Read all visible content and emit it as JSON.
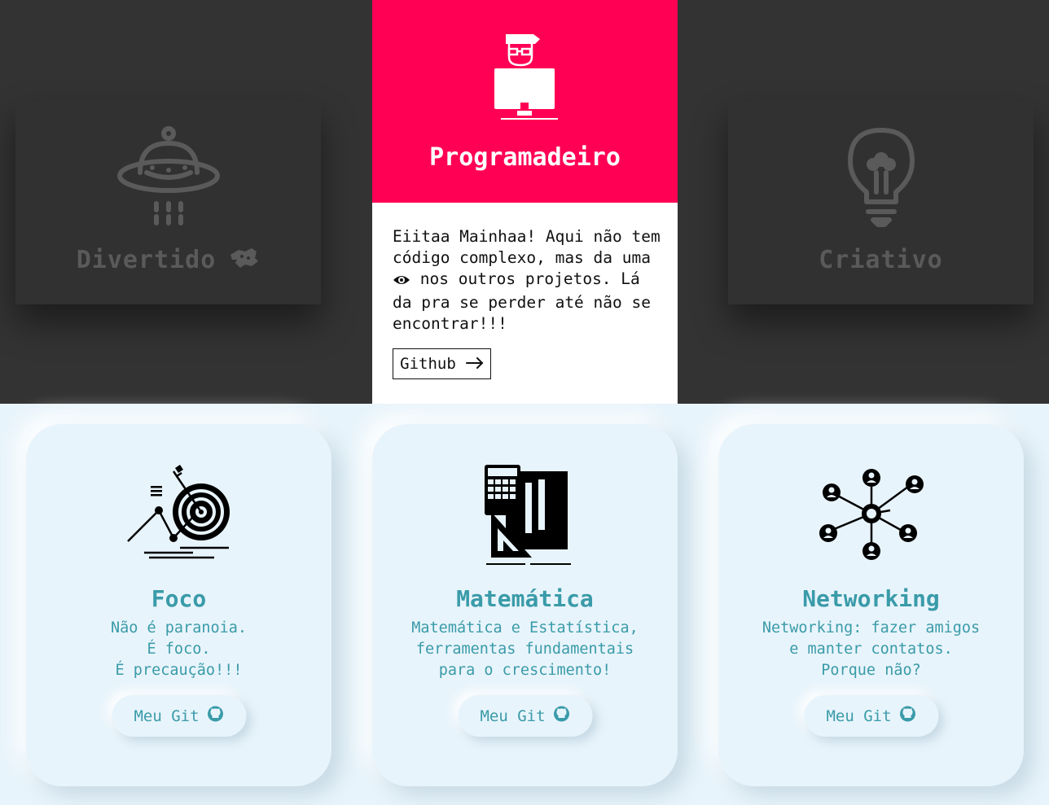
{
  "top": {
    "left_card": {
      "label": "Divertido",
      "icon": "ufo-icon",
      "emoji_icon": "hand-gesture-icon"
    },
    "center_card": {
      "title": "Programadeiro",
      "icon": "programmer-at-computer-icon",
      "text_before_eye": "Eiitaa Mainhaa! Aqui não tem código complexo, mas da uma",
      "text_after_eye": "nos outros projetos. Lá da pra se perder até não se encontrar!!!",
      "button_label": "Github",
      "button_icon": "arrow-right-icon"
    },
    "right_card": {
      "label": "Criativo",
      "icon": "lightbulb-icon"
    }
  },
  "cards": [
    {
      "title": "Foco",
      "desc": [
        "Não é paranoia.",
        "É foco.",
        "É precaução!!!"
      ],
      "button": "Meu Git",
      "icon": "target-goal-icon"
    },
    {
      "title": "Matemática",
      "desc": [
        "Matemática e Estatística,",
        "ferramentas fundamentais",
        "para o crescimento!"
      ],
      "button": "Meu Git",
      "icon": "math-tools-icon"
    },
    {
      "title": "Networking",
      "desc": [
        "Networking: fazer amigos",
        "e manter contatos.",
        "Porque não?"
      ],
      "button": "Meu Git",
      "icon": "network-icon"
    }
  ],
  "colors": {
    "accent": "#ff0055",
    "teal": "#3a9ba9",
    "dark": "#333333",
    "light_bg": "#e8f4fb"
  }
}
